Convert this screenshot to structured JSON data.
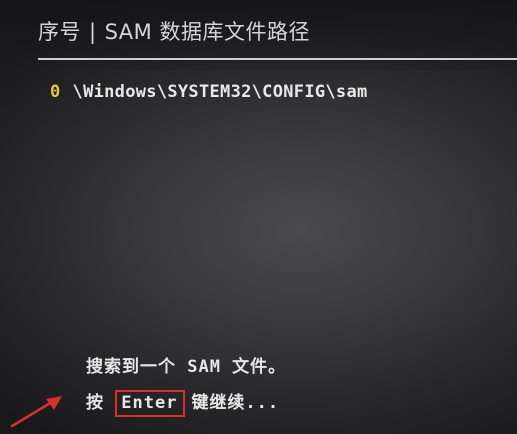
{
  "header": {
    "col_index": "序号",
    "separator": "|",
    "col_path": "SAM 数据库文件路径"
  },
  "entries": [
    {
      "index": "0",
      "path": "\\Windows\\SYSTEM32\\CONFIG\\sam"
    }
  ],
  "messages": {
    "found": "搜索到一个 SAM 文件。",
    "press_prefix": "按",
    "press_key": "Enter",
    "press_suffix": "键继续..."
  },
  "colors": {
    "index_color": "#e3c840",
    "highlight_box": "#d8302a",
    "annotation_arrow": "#d8302a"
  }
}
